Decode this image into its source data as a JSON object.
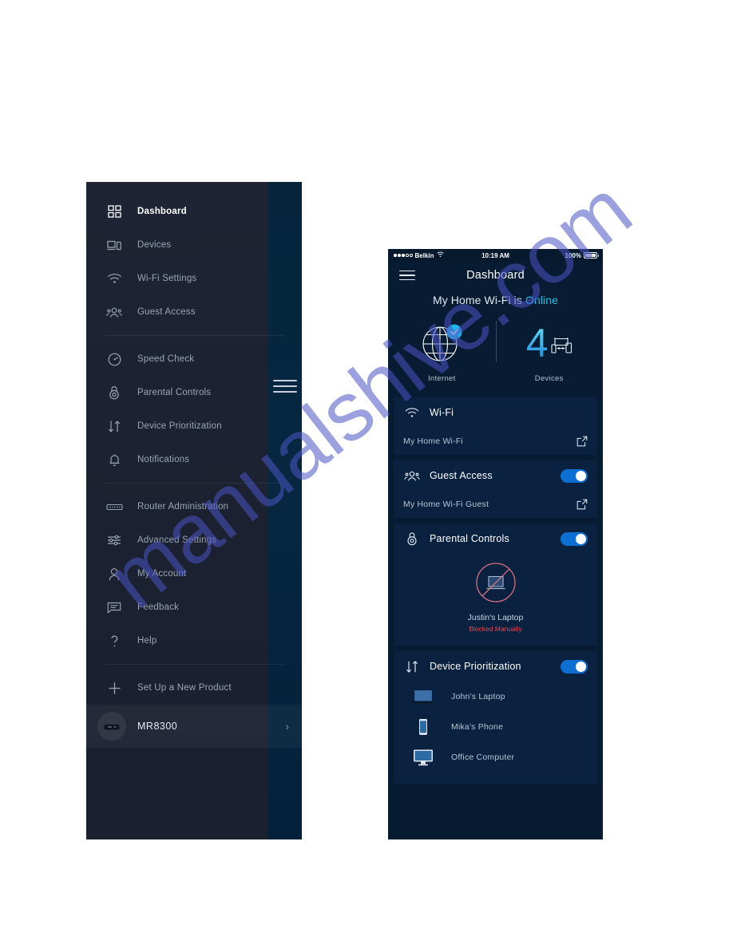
{
  "sidebar": {
    "hamburger_icon": "hamburger-menu-icon",
    "items": [
      {
        "label": "Dashboard",
        "icon": "dashboard-grid-icon",
        "active": true
      },
      {
        "label": "Devices",
        "icon": "devices-icon",
        "active": false
      },
      {
        "label": "Wi-Fi Settings",
        "icon": "wifi-icon",
        "active": false
      },
      {
        "label": "Guest Access",
        "icon": "guest-people-icon",
        "active": false
      },
      {
        "label": "Speed Check",
        "icon": "speedometer-icon",
        "active": false
      },
      {
        "label": "Parental Controls",
        "icon": "lock-icon",
        "active": false
      },
      {
        "label": "Device Prioritization",
        "icon": "up-down-arrows-icon",
        "active": false
      },
      {
        "label": "Notifications",
        "icon": "bell-icon",
        "active": false
      },
      {
        "label": "Router Administration",
        "icon": "router-icon",
        "active": false
      },
      {
        "label": "Advanced Settings",
        "icon": "sliders-icon",
        "active": false
      },
      {
        "label": "My Account",
        "icon": "person-icon",
        "active": false
      },
      {
        "label": "Feedback",
        "icon": "chat-bubble-icon",
        "active": false
      },
      {
        "label": "Help",
        "icon": "question-mark-icon",
        "active": false
      },
      {
        "label": "Set Up a New Product",
        "icon": "plus-icon",
        "active": false
      }
    ],
    "router": {
      "name": "MR8300",
      "avatar_icon": "router-device-icon",
      "chevron": "›"
    }
  },
  "phone": {
    "statusbar": {
      "carrier": "Belkin",
      "wifi_icon": "wifi-status-icon",
      "time": "10:19 AM",
      "battery_percent": "100%"
    },
    "header": {
      "menu_icon": "hamburger-menu-icon",
      "title": "Dashboard"
    },
    "hero": {
      "tagline_prefix": "My Home Wi-Fi is ",
      "tagline_status": "Online",
      "internet": {
        "icon": "globe-icon",
        "badge_icon": "check-badge-icon",
        "caption": "Internet"
      },
      "devices": {
        "count": "4",
        "icon": "devices-icon",
        "caption": "Devices"
      }
    },
    "cards": {
      "wifi": {
        "icon": "wifi-icon",
        "title": "Wi-Fi",
        "network_name": "My Home Wi-Fi",
        "external_icon": "external-link-icon"
      },
      "guest_access": {
        "icon": "guest-people-icon",
        "title": "Guest Access",
        "toggle_on": true,
        "network_name": "My Home Wi-Fi Guest",
        "external_icon": "external-link-icon"
      },
      "parental_controls": {
        "icon": "lock-icon",
        "title": "Parental Controls",
        "toggle_on": true,
        "blocked_device": "Justin's Laptop",
        "blocked_status": "Blocked Manually",
        "blocked_icon": "laptop-blocked-icon"
      },
      "device_prioritization": {
        "icon": "up-down-arrows-icon",
        "title": "Device Prioritization",
        "toggle_on": true,
        "devices": [
          {
            "name": "John's Laptop",
            "icon": "laptop-icon"
          },
          {
            "name": "Mika's Phone",
            "icon": "phone-icon"
          },
          {
            "name": "Office Computer",
            "icon": "desktop-icon"
          }
        ]
      }
    }
  },
  "watermark": {
    "text": "manualshive.com"
  },
  "colors": {
    "accent_cyan": "#1fc3e8",
    "toggle_blue": "#0d6fd4",
    "blocked_red": "#e04a5a",
    "sidebar_bg": "#1b2130",
    "phone_bg": "#071c32",
    "card_bg": "#0a2240"
  }
}
